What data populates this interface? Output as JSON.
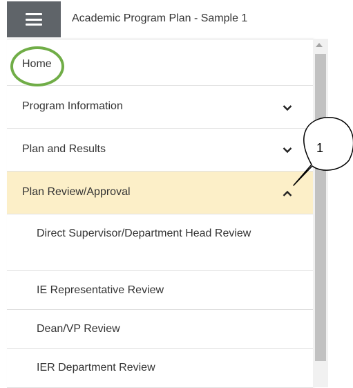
{
  "header": {
    "title": "Academic Program Plan - Sample 1",
    "menu_icon": "hamburger-menu-icon"
  },
  "nav": {
    "items": [
      {
        "label": "Home",
        "chevron": "none"
      },
      {
        "label": "Program Information",
        "chevron": "chevron-down-icon"
      },
      {
        "label": "Plan and Results",
        "chevron": "chevron-down-icon"
      },
      {
        "label": "Plan Review/Approval",
        "chevron": "chevron-up-icon",
        "expanded": true
      },
      {
        "label": "Direct Supervisor/Department Head Review"
      },
      {
        "label": "IE Representative Review"
      },
      {
        "label": "Dean/VP Review"
      },
      {
        "label": "IER Department Review"
      }
    ]
  },
  "annotation": {
    "callout_number": "1"
  },
  "colors": {
    "menu_button": "#5f6469",
    "expanded_row": "#fcefc8",
    "highlight_ring": "#70ad47"
  }
}
